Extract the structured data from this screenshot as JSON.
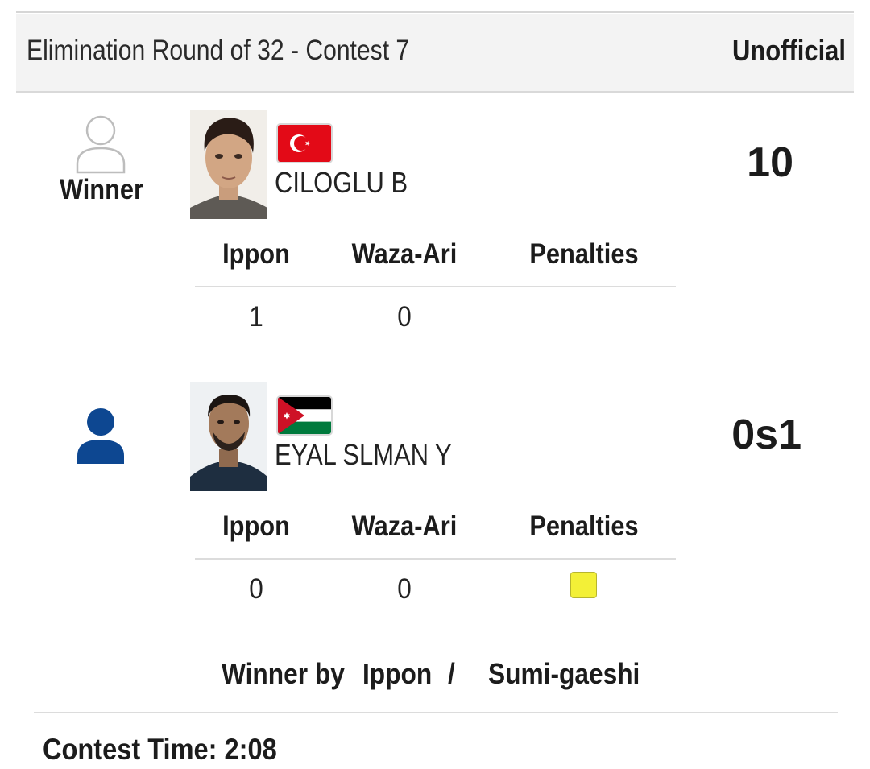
{
  "header": {
    "title": "Elimination Round of 32 - Contest 7",
    "status": "Unofficial"
  },
  "competitors": [
    {
      "name": "CILOGLU B",
      "country_flag": "Turkey",
      "winner_label": "Winner",
      "score": "10",
      "stats": {
        "headers": [
          "Ippon",
          "Waza-Ari",
          "Penalties"
        ],
        "ippon": "1",
        "waza_ari": "0",
        "penalties": 0
      },
      "icon": "person-outline-icon"
    },
    {
      "name": "EYAL SLMAN Y",
      "country_flag": "Jordan",
      "score": "0s1",
      "stats": {
        "headers": [
          "Ippon",
          "Waza-Ari",
          "Penalties"
        ],
        "ippon": "0",
        "waza_ari": "0",
        "penalties": 1
      },
      "icon": "person-filled-icon"
    }
  ],
  "result": {
    "label": "Winner by",
    "method": "Ippon",
    "separator": "/",
    "technique": "Sumi-gaeshi"
  },
  "contest_time": "Contest Time: 2:08",
  "colors": {
    "header_bg": "#f3f3f3",
    "penalty_card": "#f3f037",
    "person_filled": "#0d4791",
    "turkey_red": "#e30a17",
    "jordan_red": "#ce1126",
    "jordan_green": "#007a3d"
  }
}
